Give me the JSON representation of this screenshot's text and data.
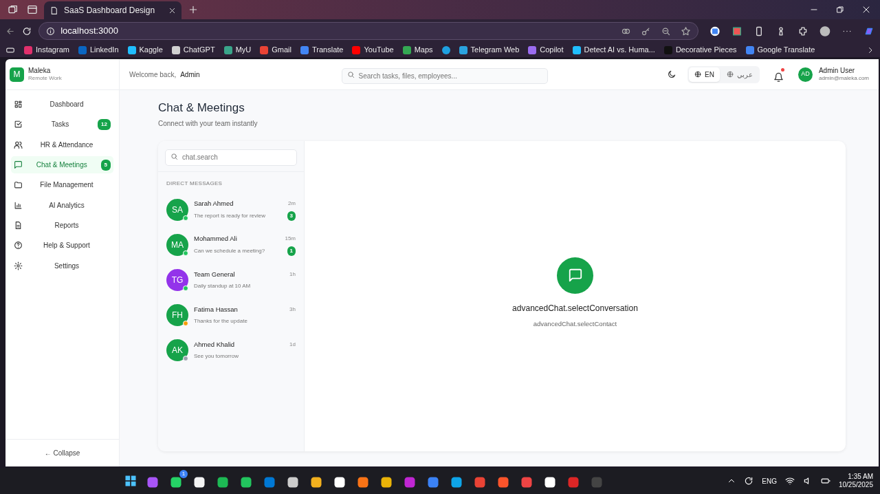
{
  "browser": {
    "tab_title": "SaaS Dashboard Design",
    "address": "localhost:3000",
    "bookmarks": [
      "Instagram",
      "LinkedIn",
      "Kaggle",
      "ChatGPT",
      "MyU",
      "Gmail",
      "Translate",
      "YouTube",
      "Maps",
      "Telegram Web",
      "Copilot",
      "Detect AI vs. Huma...",
      "Decorative Pieces",
      "Google Translate"
    ]
  },
  "app": {
    "brand": {
      "logo_letter": "M",
      "name": "Maleka",
      "subtitle": "Remote Work"
    },
    "nav": [
      {
        "label": "Dashboard",
        "selected": false
      },
      {
        "label": "Tasks",
        "badge": "12",
        "selected": false
      },
      {
        "label": "HR & Attendance",
        "selected": false
      },
      {
        "label": "Chat & Meetings",
        "badge": "5",
        "selected": true
      },
      {
        "label": "File Management",
        "selected": false
      },
      {
        "label": "AI Analytics",
        "selected": false
      },
      {
        "label": "Reports",
        "selected": false
      },
      {
        "label": "Help & Support",
        "selected": false
      },
      {
        "label": "Settings",
        "selected": false
      }
    ],
    "collapse": "← Collapse",
    "header": {
      "welcome": "Welcome back,",
      "user_name": "Admin",
      "search_placeholder": "Search tasks, files, employees...",
      "languages": [
        {
          "label": "EN",
          "selected": true
        },
        {
          "label": "عربي",
          "selected": false
        }
      ],
      "notifications_unread": true,
      "profile": {
        "initials": "AD",
        "name": "Admin User",
        "email": "admin@maleka.com"
      }
    },
    "page": {
      "title": "Chat & Meetings",
      "subtitle": "Connect with your team instantly"
    },
    "chat": {
      "search_placeholder": "chat.search",
      "section": "DIRECT MESSAGES",
      "conversations": [
        {
          "initials": "SA",
          "name": "Sarah Ahmed",
          "preview": "The report is ready for review",
          "time": "2m",
          "unread": "3",
          "color": "#16a34a",
          "status": {
            "color": "#22c55e"
          }
        },
        {
          "initials": "MA",
          "name": "Mohammed Ali",
          "preview": "Can we schedule a meeting?",
          "time": "15m",
          "unread": "1",
          "color": "#16a34a",
          "status": {
            "color": "#22c55e"
          }
        },
        {
          "initials": "TG",
          "name": "Team General",
          "preview": "Daily standup at 10 AM",
          "time": "1h",
          "color": "#9333ea",
          "status": {
            "color": "#22c55e"
          }
        },
        {
          "initials": "FH",
          "name": "Fatima Hassan",
          "preview": "Thanks for the update",
          "time": "3h",
          "color": "#16a34a",
          "status": {
            "color": "#f59e0b"
          }
        },
        {
          "initials": "AK",
          "name": "Ahmed Khalid",
          "preview": "See you tomorrow",
          "time": "1d",
          "color": "#16a34a",
          "status": {
            "color": "#9ca3af"
          }
        }
      ],
      "empty": {
        "title": "advancedChat.selectConversation",
        "subtitle": "advancedChat.selectContact"
      }
    }
  },
  "taskbar": {
    "whatsapp_badge": "1",
    "language": "ENG",
    "time": "1:35 AM",
    "date": "10/25/2025"
  }
}
